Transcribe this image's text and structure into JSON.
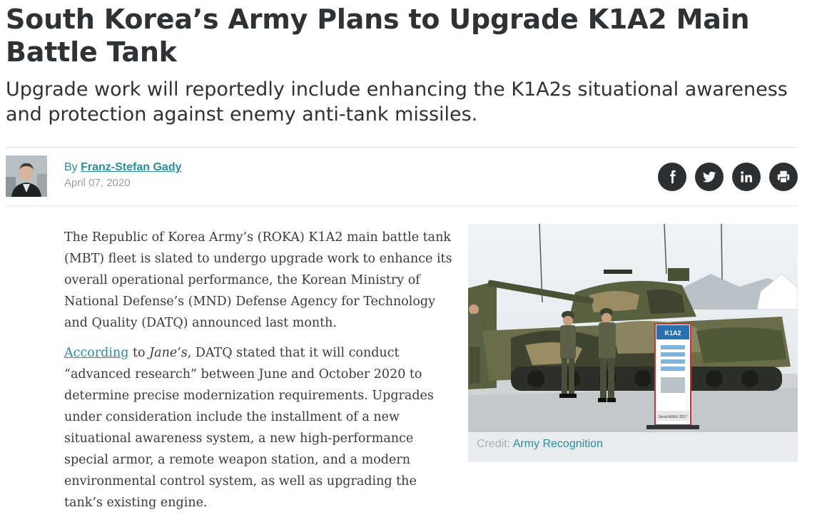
{
  "article": {
    "headline": "South Korea’s Army Plans to Upgrade K1A2 Main Battle Tank",
    "subheadline": "Upgrade work will reportedly include enhancing the K1A2s situational awareness and protection against enemy anti-tank missiles.",
    "byline": {
      "by_prefix": "By ",
      "author": "Franz-Stefan Gady",
      "date": "April 07, 2020"
    },
    "share_icons": [
      "facebook-icon",
      "twitter-icon",
      "linkedin-icon",
      "print-icon"
    ],
    "body": {
      "p1": "The Republic of Korea Army’s (ROKA) K1A2 main battle tank (MBT) fleet is slated to undergo upgrade work to enhance its overall operational performance, the Korean Ministry of National Defense’s (MND) Defense Agency for Technology and Quality (DATQ) announced last month.",
      "p2_link": "According",
      "p2_to": " to ",
      "p2_source": "Jane’s",
      "p2_rest": ", DATQ stated that it will conduct “advanced research” between June and October 2020 to determine precise modernization requirements. Upgrades under consideration include the installment of a new situational awareness system, a new high-performance special armor, a remote weapon station, and a modern environmental control system, as well as upgrading the tank’s existing engine."
    },
    "figure": {
      "credit_label": "Credit: ",
      "credit_source": "Army Recognition",
      "sign_title": "K1A2",
      "sign_footer": "Seoul ADEX 2017"
    }
  },
  "colors": {
    "accent": "#2a8d9a",
    "headline": "#2f3234",
    "share_button": "#2b2f31",
    "rule": "#e1e4e6"
  }
}
